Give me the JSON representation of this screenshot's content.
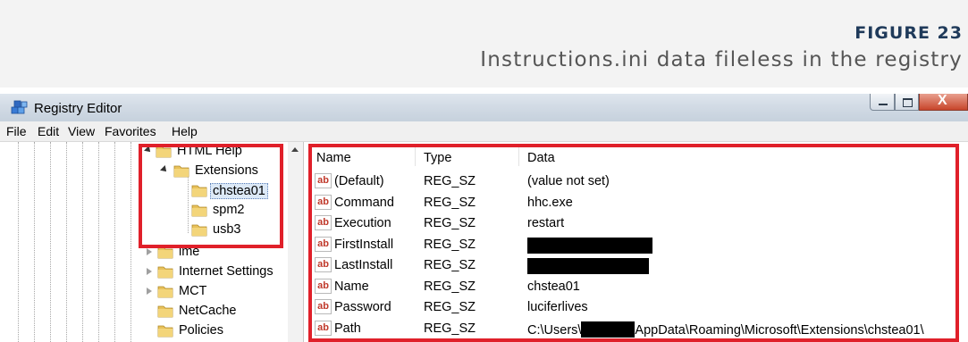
{
  "figure": {
    "title": "FIGURE 23",
    "caption": "Instructions.ini data fileless in the registry"
  },
  "window": {
    "title": "Registry Editor",
    "icon": "registry-cubes-icon",
    "controls": {
      "minimize": "minimize-icon",
      "maximize": "maximize-icon",
      "close": "X"
    }
  },
  "menu": [
    "File",
    "Edit",
    "View",
    "Favorites",
    "Help"
  ],
  "tree": [
    {
      "label": "HTML Help",
      "state": "expanded",
      "selected": false
    },
    {
      "label": "Extensions",
      "state": "expanded",
      "selected": false
    },
    {
      "label": "chstea01",
      "state": "leaf",
      "selected": true
    },
    {
      "label": "spm2",
      "state": "leaf",
      "selected": false
    },
    {
      "label": "usb3",
      "state": "leaf",
      "selected": false
    },
    {
      "label": "ime",
      "state": "collapsed",
      "selected": false
    },
    {
      "label": "Internet Settings",
      "state": "collapsed",
      "selected": false
    },
    {
      "label": "MCT",
      "state": "collapsed",
      "selected": false
    },
    {
      "label": "NetCache",
      "state": "leaf",
      "selected": false
    },
    {
      "label": "Policies",
      "state": "leaf",
      "selected": false
    }
  ],
  "columns": {
    "name": "Name",
    "type": "Type",
    "data": "Data"
  },
  "values": [
    {
      "name": "(Default)",
      "type": "REG_SZ",
      "data": "(value not set)"
    },
    {
      "name": "Command",
      "type": "REG_SZ",
      "data": "hhc.exe"
    },
    {
      "name": "Execution",
      "type": "REG_SZ",
      "data": "restart"
    },
    {
      "name": "FirstInstall",
      "type": "REG_SZ",
      "data": "",
      "redacted": true
    },
    {
      "name": "LastInstall",
      "type": "REG_SZ",
      "data": "",
      "redacted": true
    },
    {
      "name": "Name",
      "type": "REG_SZ",
      "data": "chstea01"
    },
    {
      "name": "Password",
      "type": "REG_SZ",
      "data": "luciferlives"
    },
    {
      "name": "Path",
      "type": "REG_SZ",
      "data_prefix": "C:\\Users\\",
      "data_suffix": "AppData\\Roaming\\Microsoft\\Extensions\\chstea01\\",
      "redacted_middle": true
    }
  ],
  "colors": {
    "highlight": "#e0202a",
    "figure_title": "#1f3a5a",
    "ab_icon": "#c0392b"
  }
}
